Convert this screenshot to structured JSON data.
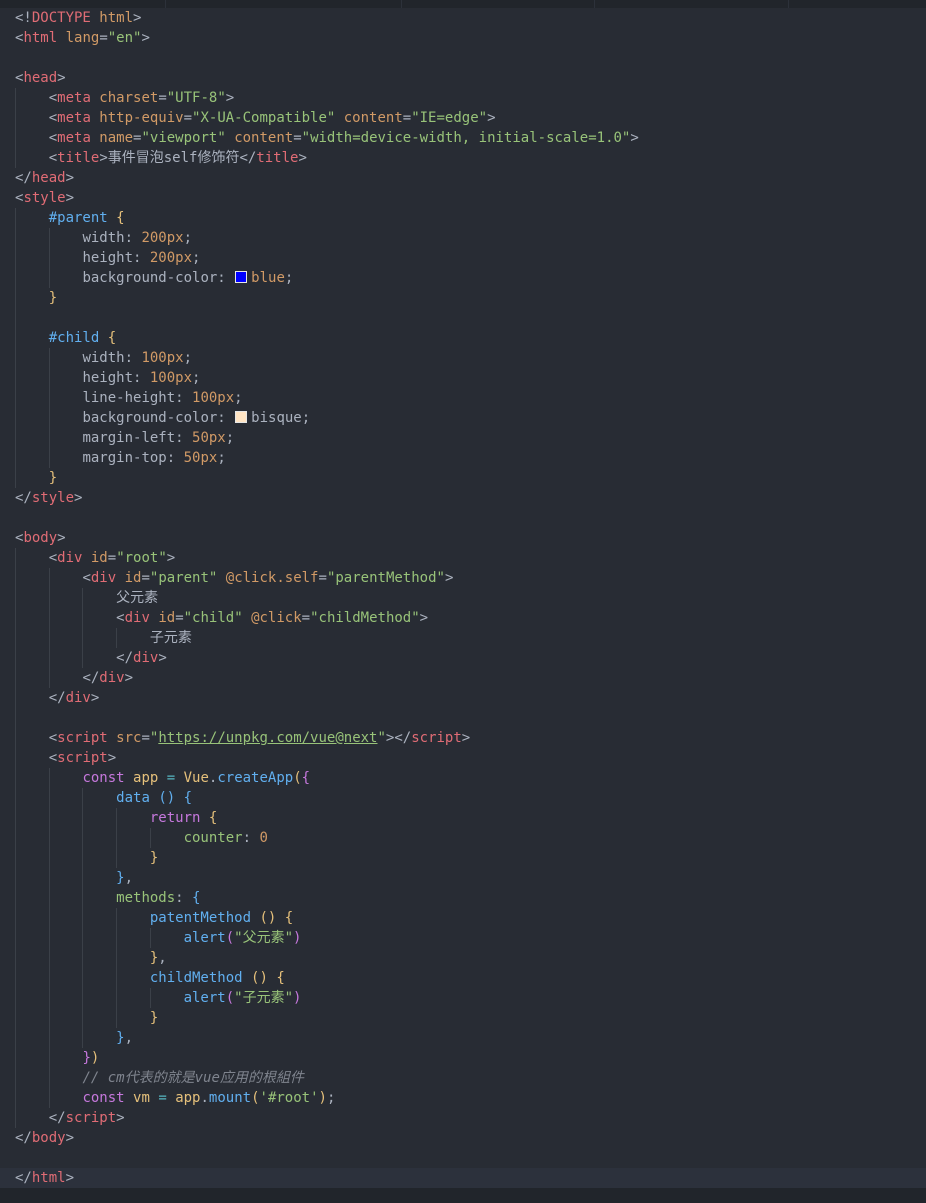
{
  "editor": {
    "language": "html",
    "theme": "dark",
    "colors": {
      "tag": "#e06c75",
      "attribute": "#d19a66",
      "string": "#98c379",
      "keyword": "#c678dd",
      "function": "#61afef",
      "comment": "#7f848e",
      "swatch_blue": "#0000ff",
      "swatch_bisque": "#ffe4c4"
    }
  },
  "lines": [
    [
      {
        "c": "t-punct",
        "t": "<!"
      },
      {
        "c": "t-tag",
        "t": "DOCTYPE"
      },
      {
        "c": "t-attr",
        "t": " html"
      },
      {
        "c": "t-punct",
        "t": ">"
      }
    ],
    [
      {
        "c": "t-punct",
        "t": "<"
      },
      {
        "c": "t-tag",
        "t": "html"
      },
      {
        "c": "t-attr",
        "t": " lang"
      },
      {
        "c": "t-punct",
        "t": "="
      },
      {
        "c": "t-str",
        "t": "\"en\""
      },
      {
        "c": "t-punct",
        "t": ">"
      }
    ],
    [],
    [
      {
        "c": "t-punct",
        "t": "<"
      },
      {
        "c": "t-tag",
        "t": "head"
      },
      {
        "c": "t-punct",
        "t": ">"
      }
    ],
    [
      {
        "c": "t-plain",
        "t": "    "
      },
      {
        "c": "t-punct",
        "t": "<"
      },
      {
        "c": "t-tag",
        "t": "meta"
      },
      {
        "c": "t-attr",
        "t": " charset"
      },
      {
        "c": "t-punct",
        "t": "="
      },
      {
        "c": "t-str",
        "t": "\"UTF-8\""
      },
      {
        "c": "t-punct",
        "t": ">"
      }
    ],
    [
      {
        "c": "t-plain",
        "t": "    "
      },
      {
        "c": "t-punct",
        "t": "<"
      },
      {
        "c": "t-tag",
        "t": "meta"
      },
      {
        "c": "t-attr",
        "t": " http-equiv"
      },
      {
        "c": "t-punct",
        "t": "="
      },
      {
        "c": "t-str",
        "t": "\"X-UA-Compatible\""
      },
      {
        "c": "t-attr",
        "t": " content"
      },
      {
        "c": "t-punct",
        "t": "="
      },
      {
        "c": "t-str",
        "t": "\"IE=edge\""
      },
      {
        "c": "t-punct",
        "t": ">"
      }
    ],
    [
      {
        "c": "t-plain",
        "t": "    "
      },
      {
        "c": "t-punct",
        "t": "<"
      },
      {
        "c": "t-tag",
        "t": "meta"
      },
      {
        "c": "t-attr",
        "t": " name"
      },
      {
        "c": "t-punct",
        "t": "="
      },
      {
        "c": "t-str",
        "t": "\"viewport\""
      },
      {
        "c": "t-attr",
        "t": " content"
      },
      {
        "c": "t-punct",
        "t": "="
      },
      {
        "c": "t-str",
        "t": "\"width=device-width, initial-scale=1.0\""
      },
      {
        "c": "t-punct",
        "t": ">"
      }
    ],
    [
      {
        "c": "t-plain",
        "t": "    "
      },
      {
        "c": "t-punct",
        "t": "<"
      },
      {
        "c": "t-tag",
        "t": "title"
      },
      {
        "c": "t-punct",
        "t": ">"
      },
      {
        "c": "t-plain",
        "t": "事件冒泡self修饰符"
      },
      {
        "c": "t-punct",
        "t": "</"
      },
      {
        "c": "t-tag",
        "t": "title"
      },
      {
        "c": "t-punct",
        "t": ">"
      }
    ],
    [
      {
        "c": "t-punct",
        "t": "</"
      },
      {
        "c": "t-tag",
        "t": "head"
      },
      {
        "c": "t-punct",
        "t": ">"
      }
    ],
    [
      {
        "c": "t-punct",
        "t": "<"
      },
      {
        "c": "t-tag",
        "t": "style"
      },
      {
        "c": "t-punct",
        "t": ">"
      }
    ],
    [
      {
        "c": "t-plain",
        "t": "    "
      },
      {
        "c": "t-sel",
        "t": "#parent"
      },
      {
        "c": "t-plain",
        "t": " "
      },
      {
        "c": "t-brace",
        "t": "{"
      }
    ],
    [
      {
        "c": "t-plain",
        "t": "        "
      },
      {
        "c": "t-prop",
        "t": "width"
      },
      {
        "c": "t-punct",
        "t": ": "
      },
      {
        "c": "t-num",
        "t": "200px"
      },
      {
        "c": "t-punct",
        "t": ";"
      }
    ],
    [
      {
        "c": "t-plain",
        "t": "        "
      },
      {
        "c": "t-prop",
        "t": "height"
      },
      {
        "c": "t-punct",
        "t": ": "
      },
      {
        "c": "t-num",
        "t": "200px"
      },
      {
        "c": "t-punct",
        "t": ";"
      }
    ],
    [
      {
        "c": "t-plain",
        "t": "        "
      },
      {
        "c": "t-prop",
        "t": "background-color"
      },
      {
        "c": "t-punct",
        "t": ": "
      },
      {
        "c": "swatch",
        "t": "#0000ff"
      },
      {
        "c": "t-num",
        "t": "blue"
      },
      {
        "c": "t-punct",
        "t": ";"
      }
    ],
    [
      {
        "c": "t-plain",
        "t": "    "
      },
      {
        "c": "t-brace",
        "t": "}"
      }
    ],
    [],
    [
      {
        "c": "t-plain",
        "t": "    "
      },
      {
        "c": "t-sel",
        "t": "#child"
      },
      {
        "c": "t-plain",
        "t": " "
      },
      {
        "c": "t-brace",
        "t": "{"
      }
    ],
    [
      {
        "c": "t-plain",
        "t": "        "
      },
      {
        "c": "t-prop",
        "t": "width"
      },
      {
        "c": "t-punct",
        "t": ": "
      },
      {
        "c": "t-num",
        "t": "100px"
      },
      {
        "c": "t-punct",
        "t": ";"
      }
    ],
    [
      {
        "c": "t-plain",
        "t": "        "
      },
      {
        "c": "t-prop",
        "t": "height"
      },
      {
        "c": "t-punct",
        "t": ": "
      },
      {
        "c": "t-num",
        "t": "100px"
      },
      {
        "c": "t-punct",
        "t": ";"
      }
    ],
    [
      {
        "c": "t-plain",
        "t": "        "
      },
      {
        "c": "t-prop",
        "t": "line-height"
      },
      {
        "c": "t-punct",
        "t": ": "
      },
      {
        "c": "t-num",
        "t": "100px"
      },
      {
        "c": "t-punct",
        "t": ";"
      }
    ],
    [
      {
        "c": "t-plain",
        "t": "        "
      },
      {
        "c": "t-prop",
        "t": "background-color"
      },
      {
        "c": "t-punct",
        "t": ": "
      },
      {
        "c": "swatch",
        "t": "#ffe4c4"
      },
      {
        "c": "t-plain",
        "t": "bisque"
      },
      {
        "c": "t-punct",
        "t": ";"
      }
    ],
    [
      {
        "c": "t-plain",
        "t": "        "
      },
      {
        "c": "t-prop",
        "t": "margin-left"
      },
      {
        "c": "t-punct",
        "t": ": "
      },
      {
        "c": "t-num",
        "t": "50px"
      },
      {
        "c": "t-punct",
        "t": ";"
      }
    ],
    [
      {
        "c": "t-plain",
        "t": "        "
      },
      {
        "c": "t-prop",
        "t": "margin-top"
      },
      {
        "c": "t-punct",
        "t": ": "
      },
      {
        "c": "t-num",
        "t": "50px"
      },
      {
        "c": "t-punct",
        "t": ";"
      }
    ],
    [
      {
        "c": "t-plain",
        "t": "    "
      },
      {
        "c": "t-brace",
        "t": "}"
      }
    ],
    [
      {
        "c": "t-punct",
        "t": "</"
      },
      {
        "c": "t-tag",
        "t": "style"
      },
      {
        "c": "t-punct",
        "t": ">"
      }
    ],
    [],
    [
      {
        "c": "t-punct",
        "t": "<"
      },
      {
        "c": "t-tag",
        "t": "body"
      },
      {
        "c": "t-punct",
        "t": ">"
      }
    ],
    [
      {
        "c": "t-plain",
        "t": "    "
      },
      {
        "c": "t-punct",
        "t": "<"
      },
      {
        "c": "t-tag",
        "t": "div"
      },
      {
        "c": "t-attr",
        "t": " id"
      },
      {
        "c": "t-punct",
        "t": "="
      },
      {
        "c": "t-str",
        "t": "\"root\""
      },
      {
        "c": "t-punct",
        "t": ">"
      }
    ],
    [
      {
        "c": "t-plain",
        "t": "        "
      },
      {
        "c": "t-punct",
        "t": "<"
      },
      {
        "c": "t-tag",
        "t": "div"
      },
      {
        "c": "t-attr",
        "t": " id"
      },
      {
        "c": "t-punct",
        "t": "="
      },
      {
        "c": "t-str",
        "t": "\"parent\""
      },
      {
        "c": "t-dir",
        "t": " @click.self"
      },
      {
        "c": "t-punct",
        "t": "="
      },
      {
        "c": "t-str",
        "t": "\"parentMethod\""
      },
      {
        "c": "t-punct",
        "t": ">"
      }
    ],
    [
      {
        "c": "t-plain",
        "t": "            父元素"
      }
    ],
    [
      {
        "c": "t-plain",
        "t": "            "
      },
      {
        "c": "t-punct",
        "t": "<"
      },
      {
        "c": "t-tag",
        "t": "div"
      },
      {
        "c": "t-attr",
        "t": " id"
      },
      {
        "c": "t-punct",
        "t": "="
      },
      {
        "c": "t-str",
        "t": "\"child\""
      },
      {
        "c": "t-dir",
        "t": " @click"
      },
      {
        "c": "t-punct",
        "t": "="
      },
      {
        "c": "t-str",
        "t": "\"childMethod\""
      },
      {
        "c": "t-punct",
        "t": ">"
      }
    ],
    [
      {
        "c": "t-plain",
        "t": "                子元素"
      }
    ],
    [
      {
        "c": "t-plain",
        "t": "            "
      },
      {
        "c": "t-punct",
        "t": "</"
      },
      {
        "c": "t-tag",
        "t": "div"
      },
      {
        "c": "t-punct",
        "t": ">"
      }
    ],
    [
      {
        "c": "t-plain",
        "t": "        "
      },
      {
        "c": "t-punct",
        "t": "</"
      },
      {
        "c": "t-tag",
        "t": "div"
      },
      {
        "c": "t-punct",
        "t": ">"
      }
    ],
    [
      {
        "c": "t-plain",
        "t": "    "
      },
      {
        "c": "t-punct",
        "t": "</"
      },
      {
        "c": "t-tag",
        "t": "div"
      },
      {
        "c": "t-punct",
        "t": ">"
      }
    ],
    [],
    [
      {
        "c": "t-plain",
        "t": "    "
      },
      {
        "c": "t-punct",
        "t": "<"
      },
      {
        "c": "t-tag",
        "t": "script"
      },
      {
        "c": "t-attr",
        "t": " src"
      },
      {
        "c": "t-punct",
        "t": "="
      },
      {
        "c": "t-str",
        "t": "\""
      },
      {
        "c": "t-link",
        "t": "https://unpkg.com/vue@next"
      },
      {
        "c": "t-str",
        "t": "\""
      },
      {
        "c": "t-punct",
        "t": "></"
      },
      {
        "c": "t-tag",
        "t": "script"
      },
      {
        "c": "t-punct",
        "t": ">"
      }
    ],
    [
      {
        "c": "t-plain",
        "t": "    "
      },
      {
        "c": "t-punct",
        "t": "<"
      },
      {
        "c": "t-tag",
        "t": "script"
      },
      {
        "c": "t-punct",
        "t": ">"
      }
    ],
    [
      {
        "c": "t-plain",
        "t": "        "
      },
      {
        "c": "t-kw",
        "t": "const"
      },
      {
        "c": "t-var",
        "t": " app"
      },
      {
        "c": "t-op",
        "t": " = "
      },
      {
        "c": "t-var",
        "t": "Vue"
      },
      {
        "c": "t-punct",
        "t": "."
      },
      {
        "c": "t-func",
        "t": "createApp"
      },
      {
        "c": "t-brace",
        "t": "("
      },
      {
        "c": "t-brace2",
        "t": "{"
      }
    ],
    [
      {
        "c": "t-plain",
        "t": "            "
      },
      {
        "c": "t-func",
        "t": "data"
      },
      {
        "c": "t-plain",
        "t": " "
      },
      {
        "c": "t-brace3",
        "t": "()"
      },
      {
        "c": "t-plain",
        "t": " "
      },
      {
        "c": "t-brace3",
        "t": "{"
      }
    ],
    [
      {
        "c": "t-plain",
        "t": "                "
      },
      {
        "c": "t-kw",
        "t": "return"
      },
      {
        "c": "t-plain",
        "t": " "
      },
      {
        "c": "t-brace",
        "t": "{"
      }
    ],
    [
      {
        "c": "t-plain",
        "t": "                    "
      },
      {
        "c": "t-str",
        "t": "counter"
      },
      {
        "c": "t-punct",
        "t": ": "
      },
      {
        "c": "t-num",
        "t": "0"
      }
    ],
    [
      {
        "c": "t-plain",
        "t": "                "
      },
      {
        "c": "t-brace",
        "t": "}"
      }
    ],
    [
      {
        "c": "t-plain",
        "t": "            "
      },
      {
        "c": "t-brace3",
        "t": "}"
      },
      {
        "c": "t-punct",
        "t": ","
      }
    ],
    [
      {
        "c": "t-plain",
        "t": "            "
      },
      {
        "c": "t-str",
        "t": "methods"
      },
      {
        "c": "t-punct",
        "t": ": "
      },
      {
        "c": "t-brace3",
        "t": "{"
      }
    ],
    [
      {
        "c": "t-plain",
        "t": "                "
      },
      {
        "c": "t-func",
        "t": "patentMethod"
      },
      {
        "c": "t-plain",
        "t": " "
      },
      {
        "c": "t-brace",
        "t": "()"
      },
      {
        "c": "t-plain",
        "t": " "
      },
      {
        "c": "t-brace",
        "t": "{"
      }
    ],
    [
      {
        "c": "t-plain",
        "t": "                    "
      },
      {
        "c": "t-func",
        "t": "alert"
      },
      {
        "c": "t-brace2",
        "t": "("
      },
      {
        "c": "t-str",
        "t": "\"父元素\""
      },
      {
        "c": "t-brace2",
        "t": ")"
      }
    ],
    [
      {
        "c": "t-plain",
        "t": "                "
      },
      {
        "c": "t-brace",
        "t": "}"
      },
      {
        "c": "t-punct",
        "t": ","
      }
    ],
    [
      {
        "c": "t-plain",
        "t": "                "
      },
      {
        "c": "t-func",
        "t": "childMethod"
      },
      {
        "c": "t-plain",
        "t": " "
      },
      {
        "c": "t-brace",
        "t": "()"
      },
      {
        "c": "t-plain",
        "t": " "
      },
      {
        "c": "t-brace",
        "t": "{"
      }
    ],
    [
      {
        "c": "t-plain",
        "t": "                    "
      },
      {
        "c": "t-func",
        "t": "alert"
      },
      {
        "c": "t-brace2",
        "t": "("
      },
      {
        "c": "t-str",
        "t": "\"子元素\""
      },
      {
        "c": "t-brace2",
        "t": ")"
      }
    ],
    [
      {
        "c": "t-plain",
        "t": "                "
      },
      {
        "c": "t-brace",
        "t": "}"
      }
    ],
    [
      {
        "c": "t-plain",
        "t": "            "
      },
      {
        "c": "t-brace3",
        "t": "}"
      },
      {
        "c": "t-punct",
        "t": ","
      }
    ],
    [
      {
        "c": "t-plain",
        "t": "        "
      },
      {
        "c": "t-brace2",
        "t": "}"
      },
      {
        "c": "t-brace",
        "t": ")"
      }
    ],
    [
      {
        "c": "t-plain",
        "t": "        "
      },
      {
        "c": "t-comment",
        "t": "// cm代表的就是vue应用的根組件"
      }
    ],
    [
      {
        "c": "t-plain",
        "t": "        "
      },
      {
        "c": "t-kw",
        "t": "const"
      },
      {
        "c": "t-var",
        "t": " vm"
      },
      {
        "c": "t-op",
        "t": " = "
      },
      {
        "c": "t-var",
        "t": "app"
      },
      {
        "c": "t-punct",
        "t": "."
      },
      {
        "c": "t-func",
        "t": "mount"
      },
      {
        "c": "t-brace",
        "t": "("
      },
      {
        "c": "t-str",
        "t": "'#root'"
      },
      {
        "c": "t-brace",
        "t": ")"
      },
      {
        "c": "t-punct",
        "t": ";"
      }
    ],
    [
      {
        "c": "t-plain",
        "t": "    "
      },
      {
        "c": "t-punct",
        "t": "</"
      },
      {
        "c": "t-tag",
        "t": "script"
      },
      {
        "c": "t-punct",
        "t": ">"
      }
    ],
    [
      {
        "c": "t-punct",
        "t": "</"
      },
      {
        "c": "t-tag",
        "t": "body"
      },
      {
        "c": "t-punct",
        "t": ">"
      }
    ],
    [],
    [
      {
        "c": "t-punct",
        "t": "</"
      },
      {
        "c": "t-tag",
        "t": "html"
      },
      {
        "c": "t-punct",
        "t": ">"
      }
    ]
  ],
  "indent_guides": [
    [],
    [],
    [],
    [],
    [
      1
    ],
    [
      1
    ],
    [
      1
    ],
    [
      1
    ],
    [],
    [],
    [
      1
    ],
    [
      1,
      2
    ],
    [
      1,
      2
    ],
    [
      1,
      2
    ],
    [
      1
    ],
    [
      1
    ],
    [
      1
    ],
    [
      1,
      2
    ],
    [
      1,
      2
    ],
    [
      1,
      2
    ],
    [
      1,
      2
    ],
    [
      1,
      2
    ],
    [
      1,
      2
    ],
    [
      1
    ],
    [],
    [],
    [],
    [
      1
    ],
    [
      1,
      2
    ],
    [
      1,
      2,
      3
    ],
    [
      1,
      2,
      3
    ],
    [
      1,
      2,
      3,
      4
    ],
    [
      1,
      2,
      3
    ],
    [
      1,
      2
    ],
    [
      1
    ],
    [
      1
    ],
    [
      1
    ],
    [
      1
    ],
    [
      1,
      2
    ],
    [
      1,
      2,
      3
    ],
    [
      1,
      2,
      3,
      4
    ],
    [
      1,
      2,
      3,
      4,
      5
    ],
    [
      1,
      2,
      3,
      4
    ],
    [
      1,
      2,
      3
    ],
    [
      1,
      2,
      3
    ],
    [
      1,
      2,
      3,
      4
    ],
    [
      1,
      2,
      3,
      4,
      5
    ],
    [
      1,
      2,
      3,
      4
    ],
    [
      1,
      2,
      3,
      4
    ],
    [
      1,
      2,
      3,
      4,
      5
    ],
    [
      1,
      2,
      3,
      4
    ],
    [
      1,
      2,
      3
    ],
    [
      1,
      2
    ],
    [
      1,
      2
    ],
    [
      1,
      2
    ],
    [
      1
    ],
    [],
    [],
    []
  ]
}
